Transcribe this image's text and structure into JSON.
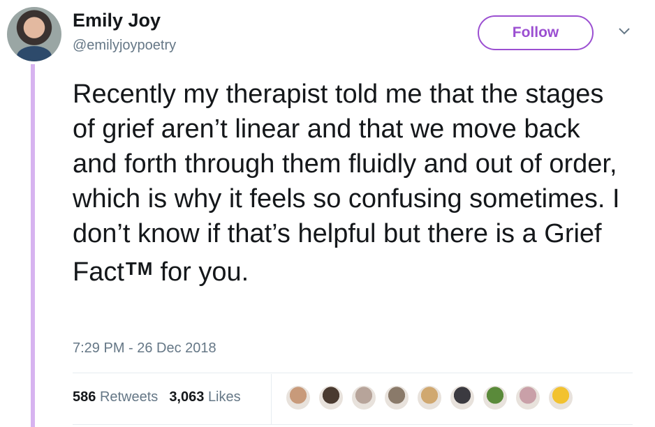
{
  "author": {
    "name": "Emily Joy",
    "handle": "@emilyjoypoetry"
  },
  "follow_label": "Follow",
  "tweet": {
    "text_main": "Recently my therapist told me that the stages of grief aren’t linear and that we move back and forth through them fluidly and out of order, which is why it feels so confusing sometimes. I don’t know if that’s helpful but there is a Grief Fact",
    "tm": "TM",
    "text_end": "for you."
  },
  "timestamp": "7:29 PM - 26 Dec 2018",
  "stats": {
    "retweets_count": "586",
    "retweets_label": "Retweets",
    "likes_count": "3,063",
    "likes_label": "Likes"
  },
  "likers": [
    {
      "color": "#c89a7a"
    },
    {
      "color": "#4a3a30"
    },
    {
      "color": "#b7a49a"
    },
    {
      "color": "#8a7a6a"
    },
    {
      "color": "#d0a870"
    },
    {
      "color": "#3b3a40"
    },
    {
      "color": "#5a8a3a"
    },
    {
      "color": "#c9a0a8"
    },
    {
      "color": "#f2c230"
    }
  ],
  "colors": {
    "accent": "#9b4fd1",
    "thread": "#d7b3f0",
    "muted": "#657786"
  }
}
